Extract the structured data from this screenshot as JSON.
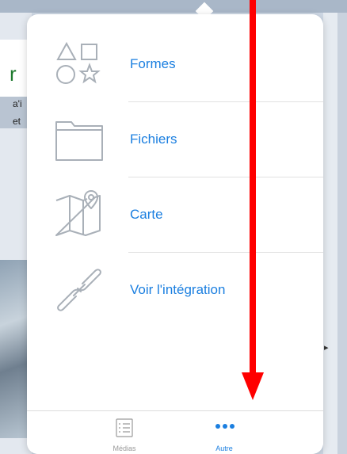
{
  "background": {
    "left_title": "r",
    "left_line1": "a'i",
    "left_line2": "et"
  },
  "menu": {
    "items": [
      {
        "label": "Formes",
        "icon": "shapes-icon"
      },
      {
        "label": "Fichiers",
        "icon": "folder-icon"
      },
      {
        "label": "Carte",
        "icon": "map-icon"
      },
      {
        "label": "Voir l'intégration",
        "icon": "link-icon"
      }
    ]
  },
  "tabs": [
    {
      "label": "Médias",
      "icon": "media-list-icon",
      "selected": false
    },
    {
      "label": "Autre",
      "icon": "more-dots-icon",
      "selected": true
    }
  ],
  "colors": {
    "accent": "#1b7fe0",
    "icon_stroke": "#a9b0b8",
    "annotation_arrow": "#ff0000"
  }
}
